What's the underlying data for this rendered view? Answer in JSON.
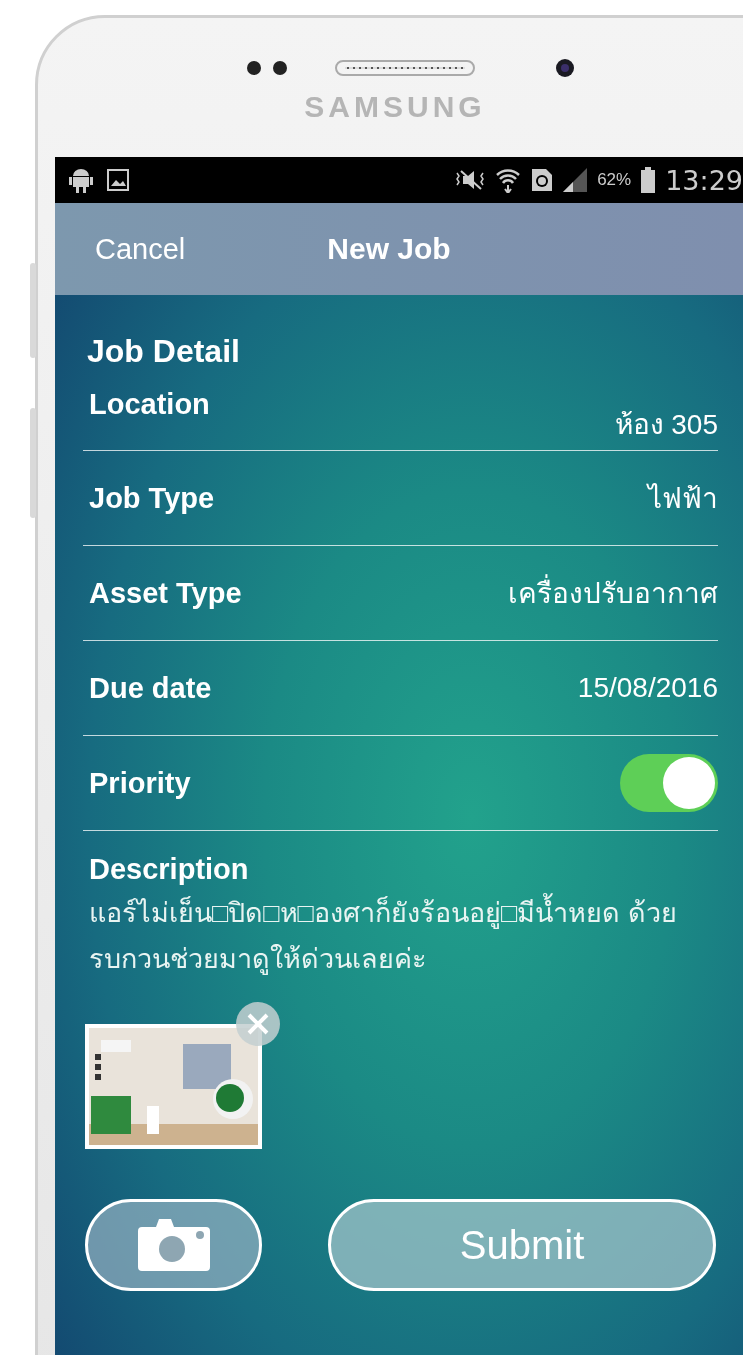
{
  "device": {
    "brand": "SAMSUNG"
  },
  "status_bar": {
    "battery_percent": "62%",
    "time": "13:29"
  },
  "nav": {
    "cancel": "Cancel",
    "title": "New Job"
  },
  "section_title": "Job Detail",
  "fields": [
    {
      "kind": "value",
      "label": "Location",
      "value": "ห้อง 305"
    },
    {
      "kind": "value",
      "label": "Job Type",
      "value": "ไฟฟ้า"
    },
    {
      "kind": "value",
      "label": "Asset Type",
      "value": "เครื่องปรับอากาศ"
    },
    {
      "kind": "value",
      "label": "Due date",
      "value": "15/08/2016"
    },
    {
      "kind": "toggle",
      "label": "Priority",
      "on": true
    }
  ],
  "description": {
    "label": "Description",
    "text": "แอร์ไม่เย็น□ปิด□ห□องศาก็ยังร้อนอยู่□มีน้ำหยด ด้วยรบกวนช่วยมาดูให้ด่วนเลยค่ะ"
  },
  "submit": "Submit"
}
